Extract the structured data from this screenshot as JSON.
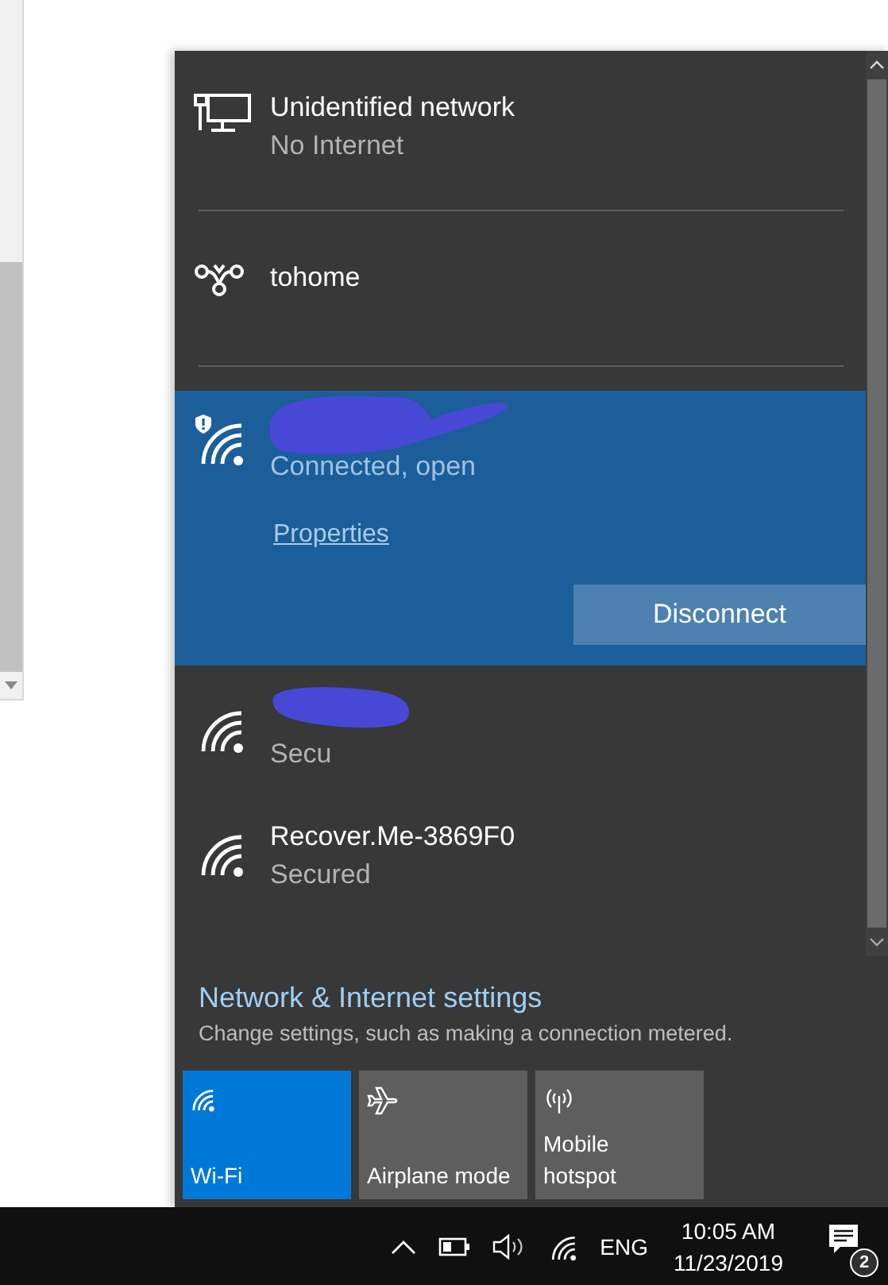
{
  "networks": [
    {
      "kind": "ethernet",
      "name": "Unidentified network",
      "status": "No Internet",
      "selected": false
    },
    {
      "kind": "dialup",
      "name": "tohome",
      "selected": false
    },
    {
      "kind": "wifi",
      "redacted": true,
      "status": "Connected, open",
      "warning": true,
      "selected": true,
      "link": "Properties",
      "button": "Disconnect"
    },
    {
      "kind": "wifi",
      "redacted": true,
      "status": "Secu",
      "selected": false
    },
    {
      "kind": "wifi",
      "name": "Recover.Me-3869F0",
      "status": "Secured",
      "selected": false
    }
  ],
  "settings": {
    "title": "Network & Internet settings",
    "description": "Change settings, such as making a connection metered."
  },
  "tiles": [
    {
      "kind": "wifi",
      "label": "Wi-Fi",
      "on": true
    },
    {
      "kind": "airplane",
      "label": "Airplane mode",
      "on": false
    },
    {
      "kind": "hotspot",
      "label": "Mobile hotspot",
      "on": false
    }
  ],
  "taskbar": {
    "language": "ENG",
    "time": "10:05 AM",
    "date": "11/23/2019",
    "notifications": "2"
  }
}
